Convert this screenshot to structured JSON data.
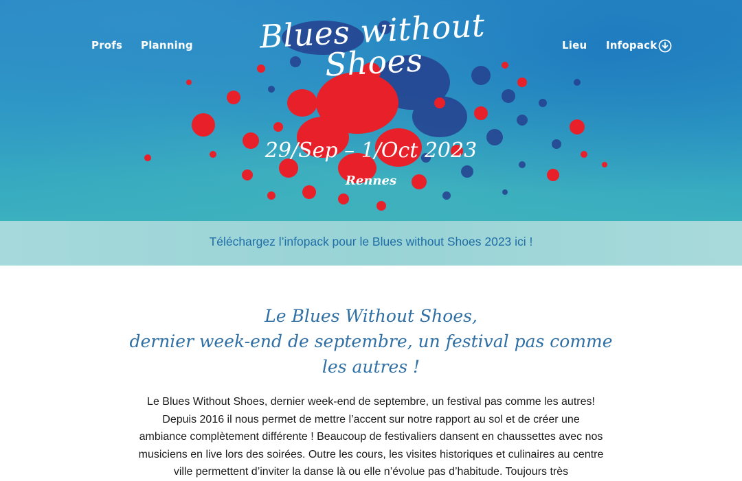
{
  "nav": {
    "profs": "Profs",
    "planning": "Planning",
    "lieu": "Lieu",
    "infopack": "Infopack",
    "infopack_icon": "download-circle-icon"
  },
  "hero": {
    "logo": "Blues without Shoes",
    "dates": "29/Sep – 1/Oct 2023",
    "city": "Rennes"
  },
  "banner": {
    "link": "Téléchargez l’infopack pour le Blues without Shoes 2023 ici !"
  },
  "main": {
    "tagline_line1": "Le Blues Without Shoes,",
    "tagline_line2": "dernier week-end de septembre, un festival pas comme",
    "tagline_line3": "les autres !",
    "intro": "Le Blues Without Shoes, dernier week-end de septembre, un festival pas comme les autres! Depuis 2016 il nous permet de mettre l’accent sur notre rapport au sol et de créer une ambiance complètement différente ! Beaucoup de festivaliers dansent en chaussettes avec nos musiciens en live lors des soirées. Outre les cours, les visites historiques et culinaires au centre ville permettent d’inviter la danse là ou elle n’évolue pas d’habitude. Toujours très"
  },
  "colors": {
    "hero_blue": "#2a86c4",
    "splash_red": "#e8202a",
    "splash_navy": "#233c8c",
    "banner_bg": "#a6d9db",
    "accent_blue": "#2f6fa4"
  }
}
